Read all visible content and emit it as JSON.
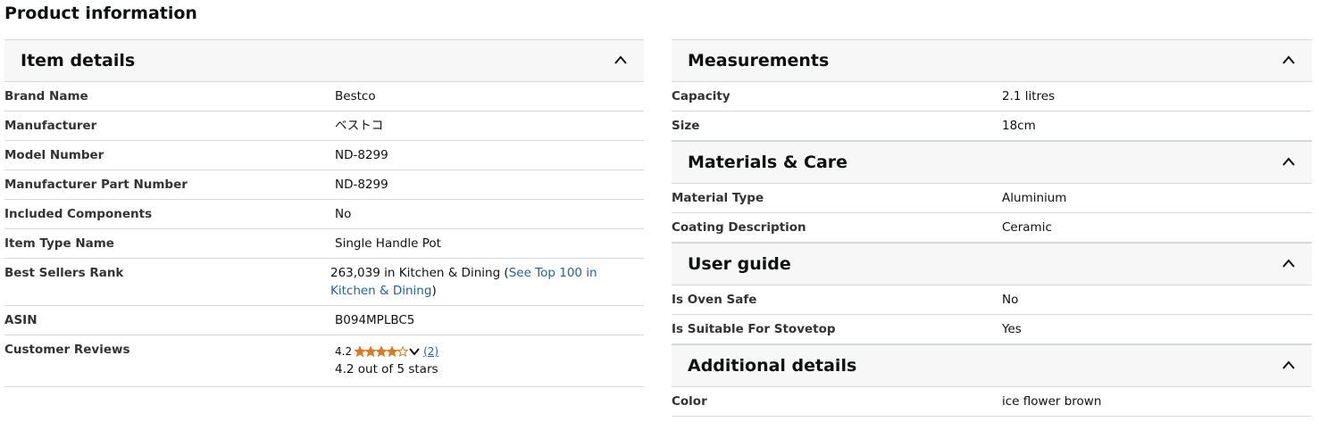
{
  "page_title": "Product information",
  "item_details": {
    "title": "Item details",
    "rows": [
      {
        "label": "Brand Name",
        "value": "Bestco"
      },
      {
        "label": "Manufacturer",
        "value": "ベストコ"
      },
      {
        "label": "Model Number",
        "value": "ND-8299"
      },
      {
        "label": "Manufacturer Part Number",
        "value": "ND-8299"
      },
      {
        "label": "Included Components",
        "value": "No"
      },
      {
        "label": "Item Type Name",
        "value": "Single Handle Pot"
      }
    ],
    "rank": {
      "label": "Best Sellers Rank",
      "prefix": "263,039 in Kitchen & Dining (",
      "link": "See Top 100 in Kitchen & Dining",
      "suffix": ")"
    },
    "asin": {
      "label": "ASIN",
      "value": "B094MPLBC5"
    },
    "reviews": {
      "label": "Customer Reviews",
      "rating": "4.2",
      "rating_fraction": 0.84,
      "count": "(2)",
      "summary": "4.2 out of 5 stars",
      "star_color": "#de7921"
    }
  },
  "measurements": {
    "title": "Measurements",
    "rows": [
      {
        "label": "Capacity",
        "value": "2.1 litres"
      },
      {
        "label": "Size",
        "value": "18cm"
      }
    ]
  },
  "materials": {
    "title": "Materials & Care",
    "rows": [
      {
        "label": "Material Type",
        "value": "Aluminium"
      },
      {
        "label": "Coating Description",
        "value": "Ceramic"
      }
    ]
  },
  "user_guide": {
    "title": "User guide",
    "rows": [
      {
        "label": "Is Oven Safe",
        "value": "No"
      },
      {
        "label": "Is Suitable For Stovetop",
        "value": "Yes"
      }
    ]
  },
  "additional": {
    "title": "Additional details",
    "rows": [
      {
        "label": "Color",
        "value": "ice flower brown"
      }
    ]
  },
  "colors": {
    "link": "#2162a1",
    "header_bg": "#f7f7f7",
    "divider": "#d5d9d9"
  }
}
